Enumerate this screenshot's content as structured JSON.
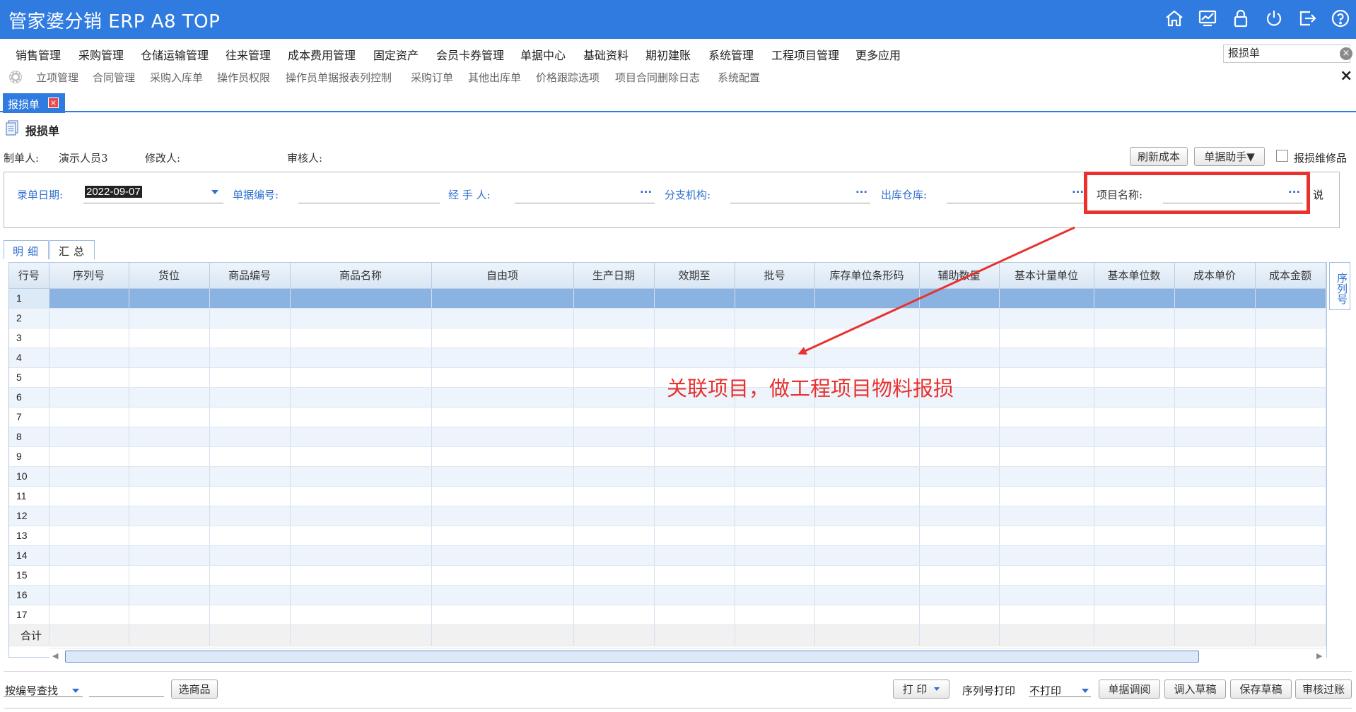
{
  "header": {
    "title": "管家婆分销 ERP A8 TOP"
  },
  "menu": {
    "items": [
      "销售管理",
      "采购管理",
      "仓储运输管理",
      "往来管理",
      "成本费用管理",
      "固定资产",
      "会员卡券管理",
      "单据中心",
      "基础资料",
      "期初建账",
      "系统管理",
      "工程项目管理",
      "更多应用"
    ],
    "search_value": "报损单"
  },
  "quickbar": {
    "items": [
      "立项管理",
      "合同管理",
      "采购入库单",
      "操作员权限",
      "操作员单据报表列控制",
      "采购订单",
      "其他出库单",
      "价格跟踪选项",
      "项目合同删除日志",
      "系统配置"
    ],
    "close": "×"
  },
  "tab": {
    "label": "报损单",
    "close": "×"
  },
  "doc": {
    "title": "报损单",
    "creator_label": "制单人:",
    "creator_value": "演示人员3",
    "modifier_label": "修改人:",
    "auditor_label": "审核人:",
    "refresh_cost": "刷新成本",
    "doc_assistant": "单据助手▼",
    "repair_goods": "报损维修品"
  },
  "form": {
    "date_label": "录单日期:",
    "date_value": "2022-09-07",
    "number_label": "单据编号:",
    "handler_label": "经 手 人:",
    "branch_label": "分支机构:",
    "warehouse_label": "出库仓库:",
    "project_label": "项目名称:",
    "dots": "···",
    "note_label": "说"
  },
  "detail_tabs": [
    "明细",
    "汇总"
  ],
  "grid": {
    "columns": [
      "行号",
      "序列号",
      "货位",
      "商品编号",
      "商品名称",
      "自由项",
      "生产日期",
      "效期至",
      "批号",
      "库存单位条形码",
      "辅助数量",
      "基本计量单位",
      "基本单位数",
      "成本单价",
      "成本金额"
    ],
    "rows": [
      "1",
      "2",
      "3",
      "4",
      "5",
      "6",
      "7",
      "8",
      "9",
      "10",
      "11",
      "12",
      "13",
      "14",
      "15",
      "16",
      "17"
    ],
    "total_label": "合计",
    "side_tab": "序列号"
  },
  "annotation": {
    "text": "关联项目，做工程项目物料报损",
    "color": "#e8322f"
  },
  "bottom": {
    "search_mode": "按编号查找",
    "select_goods": "选商品",
    "print": "打 印",
    "serial_print_label": "序列号打印",
    "serial_print_value": "不打印",
    "doc_review": "单据调阅",
    "load_draft": "调入草稿",
    "save_draft": "保存草稿",
    "audit_post": "审核过账"
  },
  "colors": {
    "header": "#2f7be0",
    "accent": "#2f6fd0",
    "selected_row": "#8bb3e2",
    "annotation": "#e8322f"
  }
}
